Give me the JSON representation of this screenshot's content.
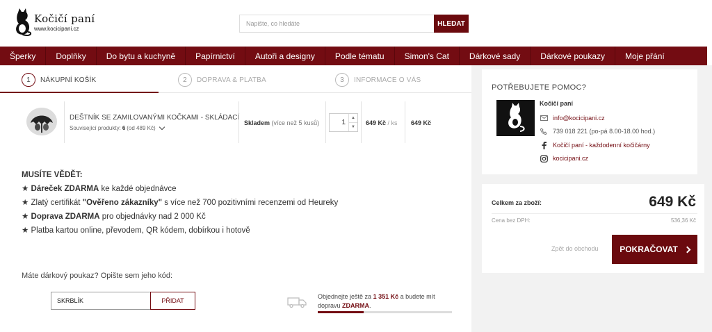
{
  "logo": {
    "name": "Kočičí paní",
    "url": "www.kocicipani.cz"
  },
  "search": {
    "placeholder": "Napište, co hledáte",
    "button": "HLEDAT"
  },
  "nav": [
    "Šperky",
    "Doplňky",
    "Do bytu a kuchyně",
    "Papírnictví",
    "Autoři a designy",
    "Podle tématu",
    "Simon's Cat",
    "Dárkové sady",
    "Dárkové poukazy",
    "Moje přání"
  ],
  "steps": [
    {
      "num": "1",
      "label": "Nákupní košík",
      "active": true
    },
    {
      "num": "2",
      "label": "Doprava & platba",
      "active": false
    },
    {
      "num": "3",
      "label": "Informace o vás",
      "active": false
    }
  ],
  "cart_item": {
    "name": "Deštník se zamilovanými kočkami - skládací",
    "related_prefix": "Související produkty:",
    "related_count": "6",
    "related_suffix": "(od 489 Kč)",
    "stock_status": "Skladem",
    "stock_detail": "(více než 5 kusů)",
    "quantity": "1",
    "unit_price": "649 Kč",
    "unit_suffix": "/ ks",
    "total": "649 Kč"
  },
  "notice": {
    "title": "Musíte vědět:",
    "lines": [
      {
        "star": "★",
        "bold": "Dáreček ZDARMA",
        "text": " ke každé objednávce"
      },
      {
        "star": "★",
        "pre": " Zlatý certifikát ",
        "bold": "\"Ověřeno zákazníky\"",
        "text": " s více než 700 pozitivními recenzemi od Heureky"
      },
      {
        "star": "★",
        "bold": "Doprava ZDARMA",
        "text": " pro objednávky nad 2 000 Kč"
      },
      {
        "star": "★",
        "text": " Platba kartou online, převodem, QR kódem, dobírkou i hotově"
      }
    ]
  },
  "voucher": {
    "label": "Máte dárkový poukaz? Opište sem jeho kód:",
    "value": "SKRBLÍK",
    "button": "Přidat"
  },
  "shipping": {
    "pre": "Objednejte ještě za ",
    "amount": "1 351 Kč",
    "mid": " a budete mít dopravu ",
    "free": "ZDARMA",
    "post": ".",
    "progress": 0.34
  },
  "help": {
    "title": "Potřebujete pomoc?",
    "name": "Kočičí paní",
    "email": "info@kocicipani.cz",
    "phone": "739 018 221 (po-pá 8.00-18.00 hod.)",
    "facebook": "Kočičí paní - každodenní kočičárny",
    "instagram": "kocicipani.cz"
  },
  "summary": {
    "label": "Celkem za zboží:",
    "total": "649 Kč",
    "net_label": "Cena bez DPH:",
    "net_value": "536,36 Kč",
    "back": "Zpět do obchodu",
    "continue": "Pokračovat"
  },
  "colors": {
    "brand": "#730c12",
    "panel": "#f2f2f2"
  }
}
